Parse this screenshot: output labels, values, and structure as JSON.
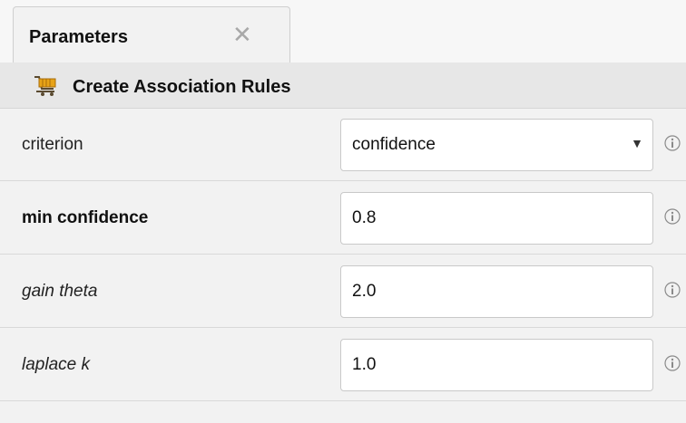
{
  "tabs": [
    {
      "label": "Parameters",
      "close_icon": "close-icon"
    }
  ],
  "operator": {
    "title": "Create Association Rules",
    "icon": "shopping-cart-icon"
  },
  "parameters": [
    {
      "label": "criterion",
      "style": "normal",
      "control": "select",
      "value": "confidence",
      "info_icon": "info-icon"
    },
    {
      "label": "min confidence",
      "style": "bold",
      "control": "input",
      "value": "0.8",
      "info_icon": "info-icon"
    },
    {
      "label": "gain theta",
      "style": "italic",
      "control": "input",
      "value": "2.0",
      "info_icon": "info-icon"
    },
    {
      "label": "laplace k",
      "style": "italic",
      "control": "input",
      "value": "1.0",
      "info_icon": "info-icon"
    }
  ],
  "symbols": {
    "close": "✕",
    "dropdown_arrow": "▼"
  },
  "colors": {
    "panel_bg": "#f2f2f2",
    "header_bg": "#e7e7e7",
    "cart_orange": "#e8a317"
  }
}
